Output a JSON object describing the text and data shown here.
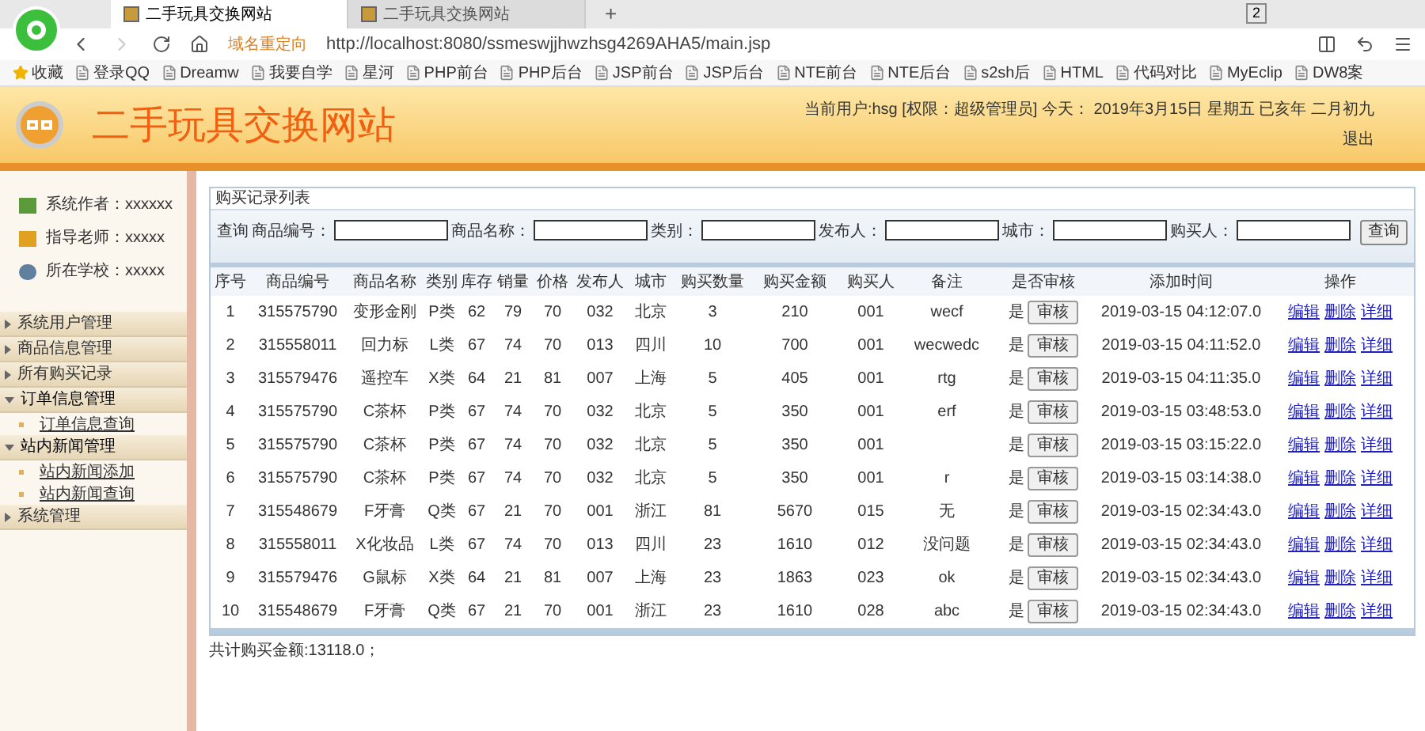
{
  "browser": {
    "tabs": [
      {
        "title": "二手玩具交换网站",
        "selected": true
      },
      {
        "title": "二手玩具交换网站",
        "selected": false
      }
    ],
    "new_tab": "+",
    "tab_count": "2",
    "redirect_label": "域名重定向",
    "url": "http://localhost:8080/ssmeswjjhwzhsg4269AHA5/main.jsp",
    "bookmarks": [
      "收藏",
      "登录QQ",
      "Dreamw",
      "我要自学",
      "星河",
      "PHP前台",
      "PHP后台",
      "JSP前台",
      "JSP后台",
      "NTE前台",
      "NTE后台",
      "s2sh后",
      "HTML",
      "代码对比",
      "MyEclip",
      "DW8案"
    ]
  },
  "header": {
    "title": "二手玩具交换网站",
    "user_info": "当前用户:hsg [权限：超级管理员] 今天： 2019年3月15日 星期五 已亥年 二月初九",
    "logout": "退出"
  },
  "sidebar": {
    "info": [
      "系统作者：xxxxxx",
      "指导老师：xxxxx",
      "所在学校：xxxxx"
    ],
    "menu": [
      {
        "label": "系统用户管理",
        "expanded": false
      },
      {
        "label": "商品信息管理",
        "expanded": false
      },
      {
        "label": "所有购买记录",
        "expanded": false
      },
      {
        "label": "订单信息管理",
        "expanded": true,
        "children": [
          "订单信息查询"
        ]
      },
      {
        "label": "站内新闻管理",
        "expanded": true,
        "children": [
          "站内新闻添加",
          "站内新闻查询"
        ]
      },
      {
        "label": "系统管理",
        "expanded": false
      }
    ]
  },
  "panel": {
    "title": "购买记录列表",
    "search_label": "查询",
    "filters": [
      "商品编号：",
      "商品名称：",
      "类别：",
      "发布人：",
      "城市：",
      "购买人："
    ],
    "search_button": "查询",
    "table": {
      "columns": [
        "序号",
        "商品编号",
        "商品名称",
        "类别",
        "库存",
        "销量",
        "价格",
        "发布人",
        "城市",
        "购买数量",
        "购买金额",
        "购买人",
        "备注",
        "是否审核",
        "添加时间",
        "操作"
      ],
      "rows": [
        {
          "cells": [
            "1",
            "315575790",
            "变形金刚",
            "P类",
            "62",
            "79",
            "70",
            "032",
            "北京",
            "3",
            "210",
            "001"
          ],
          "remark": "wecf",
          "approved": "是",
          "review_button": "审核",
          "time": "2019-03-15 04:12:07.0",
          "actions": [
            "编辑",
            "删除",
            "详细"
          ]
        },
        {
          "cells": [
            "2",
            "315558011",
            "回力标",
            "L类",
            "67",
            "74",
            "70",
            "013",
            "四川",
            "10",
            "700",
            "001"
          ],
          "remark": "wecwedc",
          "approved": "是",
          "review_button": "审核",
          "time": "2019-03-15 04:11:52.0",
          "actions": [
            "编辑",
            "删除",
            "详细"
          ]
        },
        {
          "cells": [
            "3",
            "315579476",
            "遥控车",
            "X类",
            "64",
            "21",
            "81",
            "007",
            "上海",
            "5",
            "405",
            "001"
          ],
          "remark": "rtg",
          "approved": "是",
          "review_button": "审核",
          "time": "2019-03-15 04:11:35.0",
          "actions": [
            "编辑",
            "删除",
            "详细"
          ]
        },
        {
          "cells": [
            "4",
            "315575790",
            "C茶杯",
            "P类",
            "67",
            "74",
            "70",
            "032",
            "北京",
            "5",
            "350",
            "001"
          ],
          "remark": "erf",
          "approved": "是",
          "review_button": "审核",
          "time": "2019-03-15 03:48:53.0",
          "actions": [
            "编辑",
            "删除",
            "详细"
          ]
        },
        {
          "cells": [
            "5",
            "315575790",
            "C茶杯",
            "P类",
            "67",
            "74",
            "70",
            "032",
            "北京",
            "5",
            "350",
            "001"
          ],
          "approved": "是",
          "review_button": "审核",
          "time": "2019-03-15 03:15:22.0",
          "actions": [
            "编辑",
            "删除",
            "详细"
          ]
        },
        {
          "cells": [
            "6",
            "315575790",
            "C茶杯",
            "P类",
            "67",
            "74",
            "70",
            "032",
            "北京",
            "5",
            "350",
            "001"
          ],
          "remark": "r",
          "approved": "是",
          "review_button": "审核",
          "time": "2019-03-15 03:14:38.0",
          "actions": [
            "编辑",
            "删除",
            "详细"
          ]
        },
        {
          "cells": [
            "7",
            "315548679",
            "F牙膏",
            "Q类",
            "67",
            "21",
            "70",
            "001",
            "浙江",
            "81",
            "5670",
            "015"
          ],
          "remark": "无",
          "approved": "是",
          "review_button": "审核",
          "time": "2019-03-15 02:34:43.0",
          "actions": [
            "编辑",
            "删除",
            "详细"
          ]
        },
        {
          "cells": [
            "8",
            "315558011",
            "X化妆品",
            "L类",
            "67",
            "74",
            "70",
            "013",
            "四川",
            "23",
            "1610",
            "012"
          ],
          "remark": "没问题",
          "approved": "是",
          "review_button": "审核",
          "time": "2019-03-15 02:34:43.0",
          "actions": [
            "编辑",
            "删除",
            "详细"
          ]
        },
        {
          "cells": [
            "9",
            "315579476",
            "G鼠标",
            "X类",
            "64",
            "21",
            "81",
            "007",
            "上海",
            "23",
            "1863",
            "023"
          ],
          "remark": "ok",
          "approved": "是",
          "review_button": "审核",
          "time": "2019-03-15 02:34:43.0",
          "actions": [
            "编辑",
            "删除",
            "详细"
          ]
        },
        {
          "cells": [
            "10",
            "315548679",
            "F牙膏",
            "Q类",
            "67",
            "21",
            "70",
            "001",
            "浙江",
            "23",
            "1610",
            "028"
          ],
          "remark": "abc",
          "approved": "是",
          "review_button": "审核",
          "time": "2019-03-15 02:34:43.0",
          "actions": [
            "编辑",
            "删除",
            "详细"
          ]
        }
      ]
    },
    "total": "共计购买金额:13118.0；"
  }
}
